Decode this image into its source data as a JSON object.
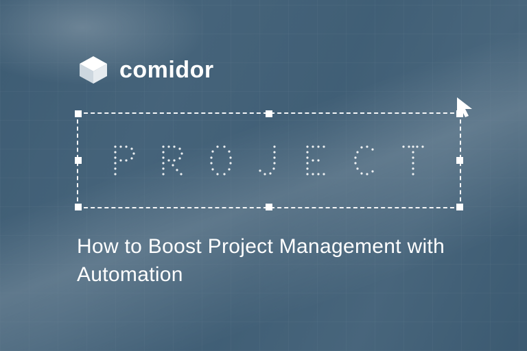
{
  "brand": {
    "name": "comidor"
  },
  "selection": {
    "placeholder_word": "PROJECT"
  },
  "headline": {
    "text": "How to Boost Project Management with Automation"
  },
  "colors": {
    "overlay": "#2c4e68",
    "foreground": "#ffffff"
  }
}
